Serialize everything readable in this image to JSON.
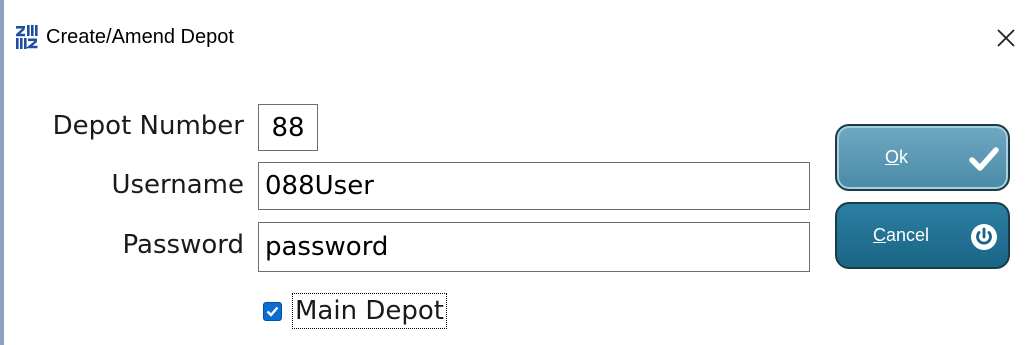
{
  "window": {
    "title": "Create/Amend Depot",
    "app_icon": "zz-app-icon",
    "close_icon": "close-icon"
  },
  "form": {
    "depot_number": {
      "label": "Depot Number",
      "value": "88"
    },
    "username": {
      "label": "Username",
      "value": "088User"
    },
    "password": {
      "label": "Password",
      "value": "password"
    },
    "main_depot": {
      "label": "Main Depot",
      "checked": true
    }
  },
  "buttons": {
    "ok": {
      "mnemonic": "O",
      "rest": "k",
      "icon": "checkmark-icon"
    },
    "cancel": {
      "mnemonic": "C",
      "rest": "ancel",
      "icon": "power-icon"
    }
  },
  "colors": {
    "ok_button": "#5b9ab5",
    "cancel_button": "#226f91",
    "checkbox": "#0a6ed1"
  }
}
